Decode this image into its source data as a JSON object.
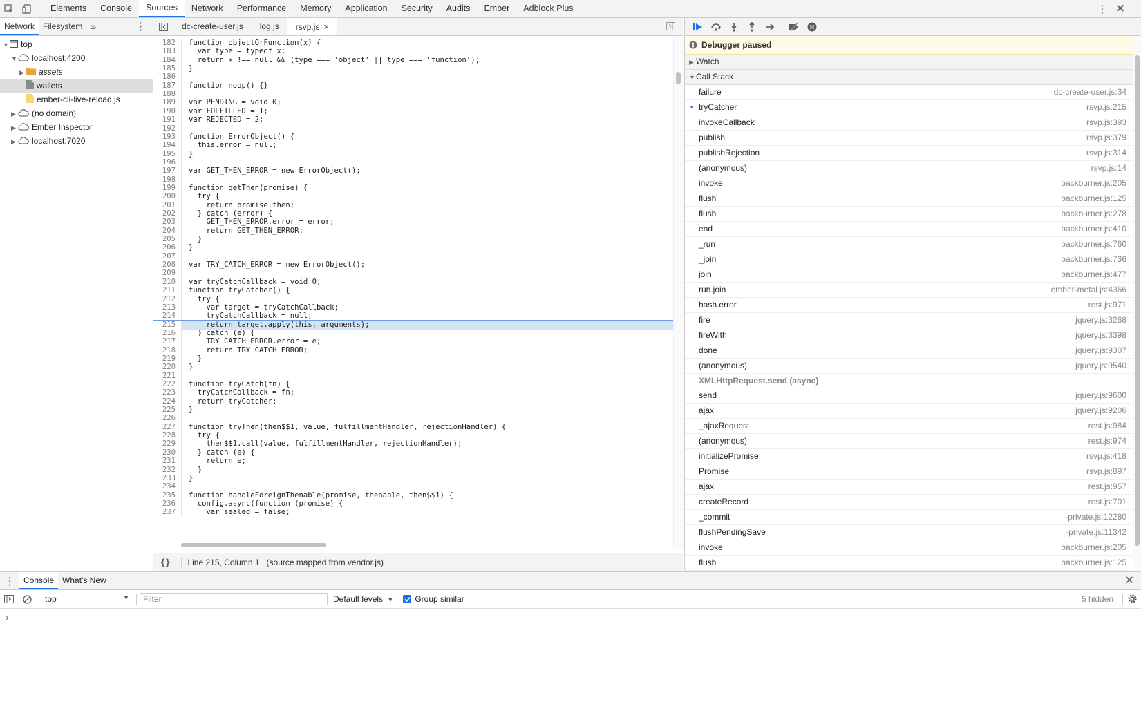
{
  "topbar": {
    "tabs": [
      "Elements",
      "Console",
      "Sources",
      "Network",
      "Performance",
      "Memory",
      "Application",
      "Security",
      "Audits",
      "Ember",
      "Adblock Plus"
    ],
    "active_tab": "Sources"
  },
  "navigator": {
    "tabs": [
      "Network",
      "Filesystem"
    ],
    "more": "»",
    "tree": [
      {
        "label": "top",
        "depth": 0,
        "arrow": "▼",
        "icon": "frame-icon"
      },
      {
        "label": "localhost:4200",
        "depth": 1,
        "arrow": "▼",
        "icon": "cloud-icon"
      },
      {
        "label": "assets",
        "depth": 2,
        "arrow": "▶",
        "icon": "folder-icon"
      },
      {
        "label": "wallets",
        "depth": 2,
        "arrow": "",
        "icon": "file-gray-icon",
        "selected": true
      },
      {
        "label": "ember-cli-live-reload.js",
        "depth": 2,
        "arrow": "",
        "icon": "file-yellow-icon"
      },
      {
        "label": "(no domain)",
        "depth": 1,
        "arrow": "▶",
        "icon": "cloud-icon"
      },
      {
        "label": "Ember Inspector",
        "depth": 1,
        "arrow": "▶",
        "icon": "cloud-icon"
      },
      {
        "label": "localhost:7020",
        "depth": 1,
        "arrow": "▶",
        "icon": "cloud-icon"
      }
    ]
  },
  "editor": {
    "tabs": [
      "dc-create-user.js",
      "log.js",
      "rsvp.js"
    ],
    "active_tab": "rsvp.js",
    "first_line": 182,
    "highlight_line": 215,
    "lines": [
      "function objectOrFunction(x) {",
      "  var type = typeof x;",
      "  return x !== null && (type === 'object' || type === 'function');",
      "}",
      "",
      "function noop() {}",
      "",
      "var PENDING = void 0;",
      "var FULFILLED = 1;",
      "var REJECTED = 2;",
      "",
      "function ErrorObject() {",
      "  this.error = null;",
      "}",
      "",
      "var GET_THEN_ERROR = new ErrorObject();",
      "",
      "function getThen(promise) {",
      "  try {",
      "    return promise.then;",
      "  } catch (error) {",
      "    GET_THEN_ERROR.error = error;",
      "    return GET_THEN_ERROR;",
      "  }",
      "}",
      "",
      "var TRY_CATCH_ERROR = new ErrorObject();",
      "",
      "var tryCatchCallback = void 0;",
      "function tryCatcher() {",
      "  try {",
      "    var target = tryCatchCallback;",
      "    tryCatchCallback = null;",
      "    return target.apply(this, arguments);",
      "  } catch (e) {",
      "    TRY_CATCH_ERROR.error = e;",
      "    return TRY_CATCH_ERROR;",
      "  }",
      "}",
      "",
      "function tryCatch(fn) {",
      "  tryCatchCallback = fn;",
      "  return tryCatcher;",
      "}",
      "",
      "function tryThen(then$$1, value, fulfillmentHandler, rejectionHandler) {",
      "  try {",
      "    then$$1.call(value, fulfillmentHandler, rejectionHandler);",
      "  } catch (e) {",
      "    return e;",
      "  }",
      "}",
      "",
      "function handleForeignThenable(promise, thenable, then$$1) {",
      "  config.async(function (promise) {",
      "    var sealed = false;"
    ],
    "status": {
      "pretty": "{}",
      "position": "Line 215, Column 1",
      "source_map": "(source mapped from vendor.js)"
    }
  },
  "debugger": {
    "paused_text": "Debugger paused",
    "watch_label": "Watch",
    "callstack_label": "Call Stack",
    "frames": [
      {
        "fn": "failure",
        "loc": "dc-create-user.js:34"
      },
      {
        "fn": "tryCatcher",
        "loc": "rsvp.js:215",
        "current": true
      },
      {
        "fn": "invokeCallback",
        "loc": "rsvp.js:393"
      },
      {
        "fn": "publish",
        "loc": "rsvp.js:379"
      },
      {
        "fn": "publishRejection",
        "loc": "rsvp.js:314"
      },
      {
        "fn": "(anonymous)",
        "loc": "rsvp.js:14"
      },
      {
        "fn": "invoke",
        "loc": "backburner.js:205"
      },
      {
        "fn": "flush",
        "loc": "backburner.js:125"
      },
      {
        "fn": "flush",
        "loc": "backburner.js:278"
      },
      {
        "fn": "end",
        "loc": "backburner.js:410"
      },
      {
        "fn": "_run",
        "loc": "backburner.js:760"
      },
      {
        "fn": "_join",
        "loc": "backburner.js:736"
      },
      {
        "fn": "join",
        "loc": "backburner.js:477"
      },
      {
        "fn": "run.join",
        "loc": "ember-metal.js:4366"
      },
      {
        "fn": "hash.error",
        "loc": "rest.js:971"
      },
      {
        "fn": "fire",
        "loc": "jquery.js:3268"
      },
      {
        "fn": "fireWith",
        "loc": "jquery.js:3398"
      },
      {
        "fn": "done",
        "loc": "jquery.js:9307"
      },
      {
        "fn": "(anonymous)",
        "loc": "jquery.js:9540"
      },
      {
        "async": "XMLHttpRequest.send (async)"
      },
      {
        "fn": "send",
        "loc": "jquery.js:9600"
      },
      {
        "fn": "ajax",
        "loc": "jquery.js:9206"
      },
      {
        "fn": "_ajaxRequest",
        "loc": "rest.js:984"
      },
      {
        "fn": "(anonymous)",
        "loc": "rest.js:974"
      },
      {
        "fn": "initializePromise",
        "loc": "rsvp.js:418"
      },
      {
        "fn": "Promise",
        "loc": "rsvp.js:897"
      },
      {
        "fn": "ajax",
        "loc": "rest.js:957"
      },
      {
        "fn": "createRecord",
        "loc": "rest.js:701"
      },
      {
        "fn": "_commit",
        "loc": "-private.js:12280"
      },
      {
        "fn": "flushPendingSave",
        "loc": "-private.js:11342"
      },
      {
        "fn": "invoke",
        "loc": "backburner.js:205"
      },
      {
        "fn": "flush",
        "loc": "backburner.js:125"
      }
    ]
  },
  "drawer": {
    "tabs": [
      "Console",
      "What's New"
    ],
    "context": "top",
    "filter_placeholder": "Filter",
    "levels": "Default levels",
    "group_similar": "Group similar",
    "hidden": "5 hidden",
    "prompt": "›"
  },
  "colors": {
    "accent": "#1a73e8",
    "selection": "#d5e3f7",
    "paused_bg": "#fffbe5"
  }
}
